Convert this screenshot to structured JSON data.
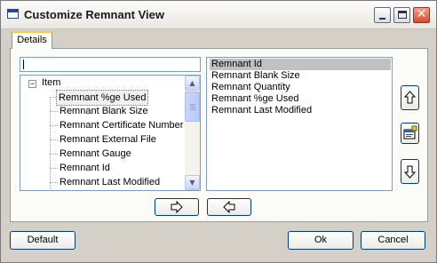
{
  "window": {
    "title": "Customize Remnant View",
    "close_glyph": "✕"
  },
  "tab": {
    "label": "Details"
  },
  "search": {
    "value": ""
  },
  "tree": {
    "root_label": "Item",
    "expander_glyph": "−",
    "items": [
      "Remnant %ge Used",
      "Remnant Blank Size",
      "Remnant Certificate Number",
      "Remnant External File",
      "Remnant Gauge",
      "Remnant Id",
      "Remnant Last Modified"
    ],
    "selected_index": 0
  },
  "selected_columns": {
    "items": [
      "Remnant Id",
      "Remnant Blank Size",
      "Remnant Quantity",
      "Remnant %ge Used",
      "Remnant Last Modified"
    ],
    "selected_index": 0
  },
  "buttons": {
    "default": "Default",
    "ok": "Ok",
    "cancel": "Cancel"
  },
  "icons": {
    "move_up": "arrow-up-icon",
    "properties": "properties-icon",
    "move_down": "arrow-down-icon",
    "add": "arrow-right-icon",
    "remove": "arrow-left-icon"
  },
  "colors": {
    "close_button": "#d8492c",
    "tab_highlight": "#ffc83c",
    "list_selection": "#c1c1c1",
    "field_border": "#7f9db9"
  }
}
